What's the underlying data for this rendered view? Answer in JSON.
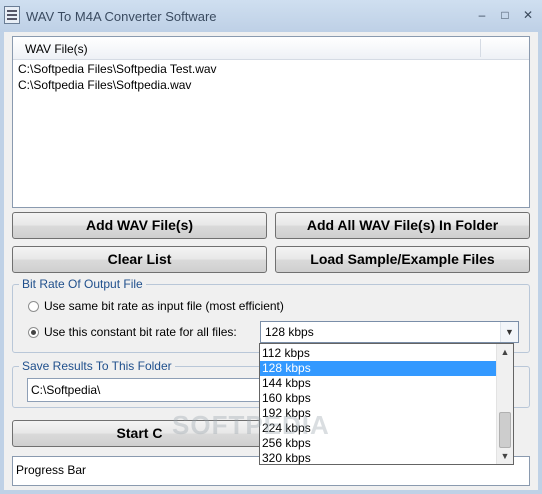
{
  "window": {
    "title": "WAV To M4A Converter Software",
    "minimize": "–",
    "maximize": "□",
    "close": "✕"
  },
  "file_list": {
    "column_header": "WAV File(s)",
    "rows": [
      "C:\\Softpedia Files\\Softpedia Test.wav",
      "C:\\Softpedia Files\\Softpedia.wav"
    ]
  },
  "buttons": {
    "add_files": "Add WAV File(s)",
    "add_folder": "Add All WAV File(s) In Folder",
    "clear_list": "Clear List",
    "load_samples": "Load Sample/Example Files",
    "start": "Start C"
  },
  "bitrate": {
    "group_label": "Bit Rate Of Output File",
    "option_same": "Use same bit rate as input file (most efficient)",
    "option_constant": "Use this constant bit rate for all files:",
    "selected": "128 kbps",
    "options": [
      "112 kbps",
      "128 kbps",
      "144 kbps",
      "160 kbps",
      "192 kbps",
      "224 kbps",
      "256 kbps",
      "320 kbps"
    ]
  },
  "output": {
    "group_label": "Save Results To This Folder",
    "folder": "C:\\Softpedia\\"
  },
  "progress": {
    "label": "Progress Bar"
  },
  "watermark": "SOFTPEDIA"
}
